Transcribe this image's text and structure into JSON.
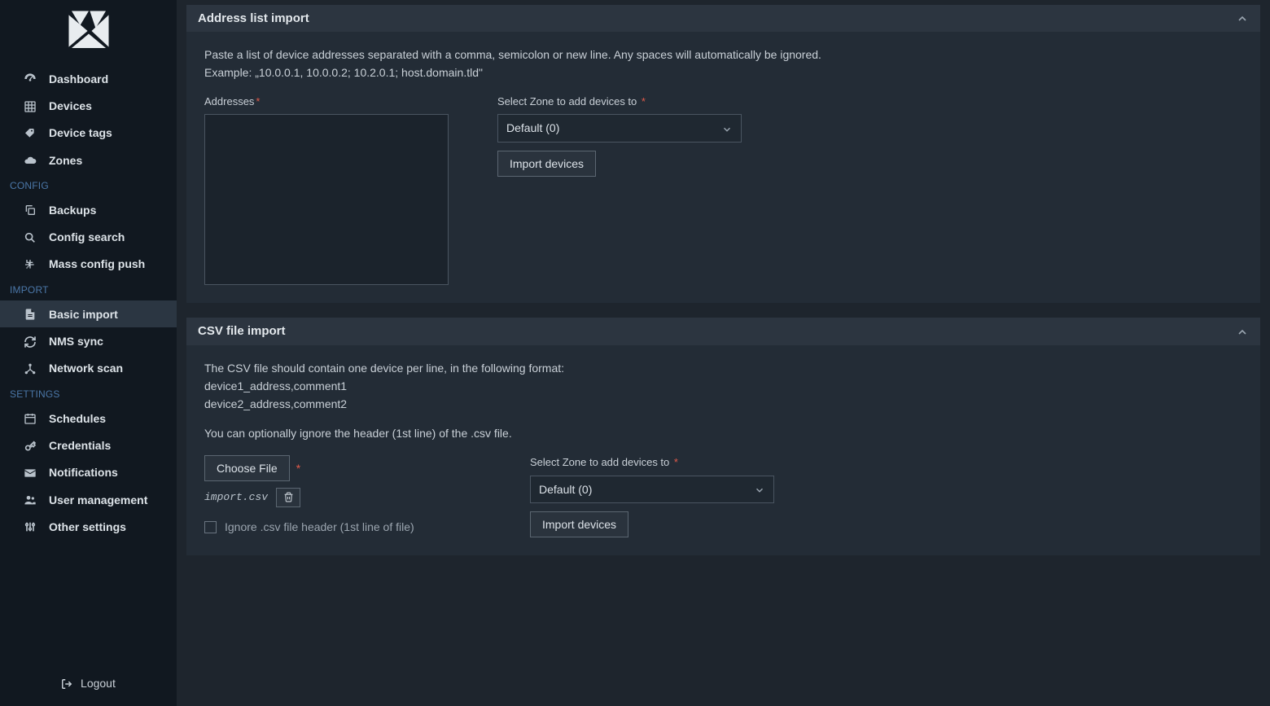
{
  "sidebar": {
    "nav": {
      "main": [
        {
          "icon": "dashboard",
          "label": "Dashboard"
        },
        {
          "icon": "grid",
          "label": "Devices"
        },
        {
          "icon": "tags",
          "label": "Device tags"
        },
        {
          "icon": "cloud",
          "label": "Zones"
        }
      ],
      "config_label": "CONFIG",
      "config": [
        {
          "icon": "copy",
          "label": "Backups"
        },
        {
          "icon": "search",
          "label": "Config search"
        },
        {
          "icon": "puzzle",
          "label": "Mass config push"
        }
      ],
      "import_label": "IMPORT",
      "import": [
        {
          "icon": "file",
          "label": "Basic import",
          "active": true
        },
        {
          "icon": "sync",
          "label": "NMS sync"
        },
        {
          "icon": "network",
          "label": "Network scan"
        }
      ],
      "settings_label": "SETTINGS",
      "settings": [
        {
          "icon": "calendar",
          "label": "Schedules"
        },
        {
          "icon": "key",
          "label": "Credentials"
        },
        {
          "icon": "mail",
          "label": "Notifications"
        },
        {
          "icon": "users",
          "label": "User management"
        },
        {
          "icon": "sliders",
          "label": "Other settings"
        }
      ]
    },
    "logout": "Logout"
  },
  "panel1": {
    "title": "Address list import",
    "desc_line1": "Paste a list of device addresses separated with a comma, semicolon or new line. Any spaces will automatically be ignored.",
    "desc_line2": "Example: „10.0.0.1, 10.0.0.2; 10.2.0.1; host.domain.tld\"",
    "addresses_label": "Addresses",
    "zone_label": "Select Zone to add devices to",
    "zone_value": "Default (0)",
    "import_btn": "Import devices"
  },
  "panel2": {
    "title": "CSV file import",
    "desc_line1": "The CSV file should contain one device per line, in the following format:",
    "desc_line2": "device1_address,comment1",
    "desc_line3": "device2_address,comment2",
    "desc_line4": "You can optionally ignore the header (1st line) of the .csv file.",
    "choose_file_btn": "Choose File",
    "file_name": "import.csv",
    "ignore_label": "Ignore .csv file header (1st line of file)",
    "zone_label": "Select Zone to add devices to",
    "zone_value": "Default (0)",
    "import_btn": "Import devices"
  }
}
